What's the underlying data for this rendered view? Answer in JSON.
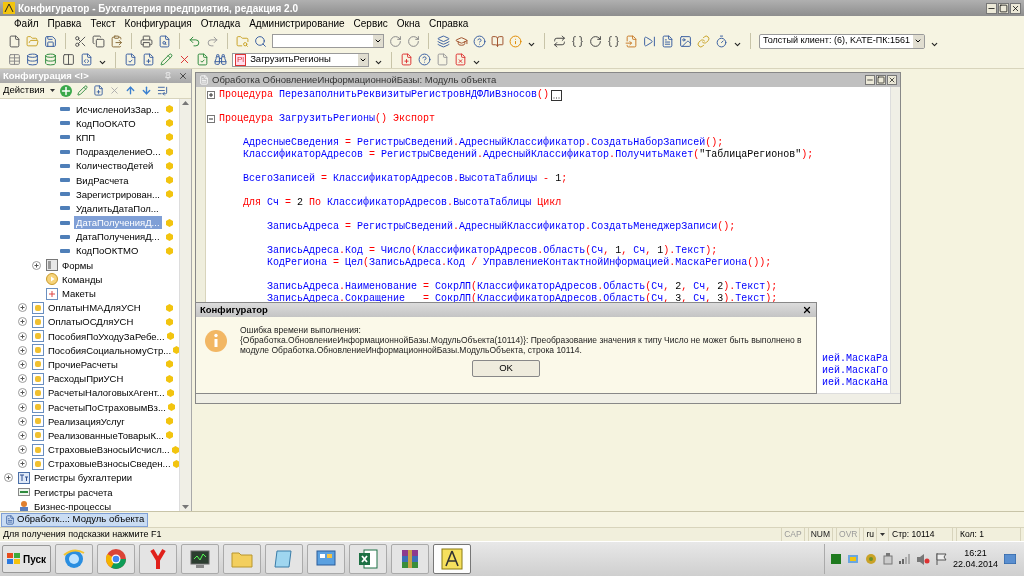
{
  "window": {
    "title": "Конфигуратор - Бухгалтерия предприятия, редакция 2.0"
  },
  "menu": [
    "Файл",
    "Правка",
    "Текст",
    "Конфигурация",
    "Отладка",
    "Администрирование",
    "Сервис",
    "Окна",
    "Справка"
  ],
  "client_combo": "Толстый клиент: (6), KATE-ПК:1561",
  "procedure_combo": {
    "badge": "Pl",
    "value": "ЗагрузитьРегионы"
  },
  "config_panel": {
    "title": "Конфигурация <!>",
    "actions": "Действия",
    "tree": [
      {
        "children": [
          {
            "children": [
              {
                "children": [
                  {
                    "label": "ИсчисленоИзЗар...",
                    "kind": "attribute",
                    "supported": true,
                    "selected": false
                  },
                  {
                    "label": "КодПоОКАТО",
                    "kind": "attribute",
                    "supported": true,
                    "selected": false
                  },
                  {
                    "label": "КПП",
                    "kind": "attribute",
                    "supported": true,
                    "selected": false
                  },
                  {
                    "label": "ПодразделениеО...",
                    "kind": "attribute",
                    "supported": true,
                    "selected": false
                  },
                  {
                    "label": "КоличествоДетей",
                    "kind": "attribute",
                    "supported": true,
                    "selected": false
                  },
                  {
                    "label": "ВидРасчета",
                    "kind": "attribute",
                    "supported": true,
                    "selected": false
                  },
                  {
                    "label": "Зарегистрирован...",
                    "kind": "attribute",
                    "supported": true,
                    "selected": false
                  },
                  {
                    "label": "УдалитьДатаПол...",
                    "kind": "attribute",
                    "supported": false,
                    "selected": false
                  },
                  {
                    "label": "ДатаПолученияД...",
                    "kind": "attribute",
                    "supported": true,
                    "selected": true
                  },
                  {
                    "label": "ДатаПолученияД...",
                    "kind": "attribute",
                    "supported": true,
                    "selected": false
                  },
                  {
                    "label": "КодПоОКТМО",
                    "kind": "attribute",
                    "supported": true,
                    "selected": false
                  }
                ]
              },
              {
                "label": "Формы",
                "kind": "forms",
                "expanded": false,
                "supported": false,
                "selected": false
              },
              {
                "label": "Команды",
                "kind": "commands",
                "supported": false,
                "selected": false
              },
              {
                "label": "Макеты",
                "kind": "templates",
                "supported": false,
                "selected": false
              }
            ]
          },
          {
            "label": "ОплатыНМАДляУСН",
            "kind": "document",
            "expanded": false,
            "supported": true,
            "selected": false
          },
          {
            "label": "ОплатыОСДляУСН",
            "kind": "document",
            "expanded": false,
            "supported": true,
            "selected": false
          },
          {
            "label": "ПособияПоУходуЗаРебе...",
            "kind": "document",
            "expanded": false,
            "supported": true,
            "selected": false
          },
          {
            "label": "ПособияСоциальномуСтр...",
            "kind": "document",
            "expanded": false,
            "supported": true,
            "selected": false
          },
          {
            "label": "ПрочиеРасчеты",
            "kind": "document",
            "expanded": false,
            "supported": true,
            "selected": false
          },
          {
            "label": "РасходыПриУСН",
            "kind": "document",
            "expanded": false,
            "supported": true,
            "selected": false
          },
          {
            "label": "РасчетыНалоговыхАгент...",
            "kind": "document",
            "expanded": false,
            "supported": true,
            "selected": false
          },
          {
            "label": "РасчетыПоСтраховымВз...",
            "kind": "document",
            "expanded": false,
            "supported": true,
            "selected": false
          },
          {
            "label": "РеализацияУслуг",
            "kind": "document",
            "expanded": false,
            "supported": true,
            "selected": false
          },
          {
            "label": "РеализованныеТоварыК...",
            "kind": "document",
            "expanded": false,
            "supported": true,
            "selected": false
          },
          {
            "label": "СтраховыеВзносыИсчисл...",
            "kind": "document",
            "expanded": false,
            "supported": true,
            "selected": false
          },
          {
            "label": "СтраховыеВзносыСведен...",
            "kind": "document",
            "expanded": false,
            "supported": true,
            "selected": false
          }
        ]
      },
      {
        "label": "Регистры бухгалтерии",
        "kind": "acc-register",
        "expanded": false,
        "supported": false,
        "selected": false
      },
      {
        "label": "Регистры расчета",
        "kind": "calc-register",
        "supported": false,
        "selected": false
      },
      {
        "label": "Бизнес-процессы",
        "kind": "business-process",
        "supported": false,
        "selected": false
      }
    ]
  },
  "editor": {
    "title": "Обработка ОбновлениеИнформационнойБазы: Модуль объекта",
    "lines": [
      {
        "kind": "code",
        "collapsed": true,
        "tokens": [
          {
            "kind": "kw",
            "text": "Процедура "
          },
          {
            "kind": "id",
            "text": "ПерезаполнитьРеквизитыРегистровНДФЛиВзносов"
          },
          {
            "kind": "op",
            "text": "()"
          }
        ]
      },
      {
        "kind": "blank"
      },
      {
        "kind": "code",
        "collapsed": false,
        "tokens": [
          {
            "kind": "kw",
            "text": "Процедура "
          },
          {
            "kind": "id",
            "text": "ЗагрузитьРегионы"
          },
          {
            "kind": "op",
            "text": "() "
          },
          {
            "kind": "kw",
            "text": "Экспорт"
          }
        ]
      },
      {
        "kind": "blank"
      },
      {
        "kind": "code",
        "tokens": [
          {
            "kind": "id",
            "text": "    АдресныеСведения "
          },
          {
            "kind": "op",
            "text": "= "
          },
          {
            "kind": "id",
            "text": "РегистрыСведений"
          },
          {
            "kind": "op",
            "text": "."
          },
          {
            "kind": "id",
            "text": "АдресныйКлассификатор"
          },
          {
            "kind": "op",
            "text": "."
          },
          {
            "kind": "id",
            "text": "СоздатьНаборЗаписей"
          },
          {
            "kind": "op",
            "text": "();"
          }
        ]
      },
      {
        "kind": "code",
        "tokens": [
          {
            "kind": "id",
            "text": "    КлассификаторАдресов "
          },
          {
            "kind": "op",
            "text": "= "
          },
          {
            "kind": "id",
            "text": "РегистрыСведений"
          },
          {
            "kind": "op",
            "text": "."
          },
          {
            "kind": "id",
            "text": "АдресныйКлассификатор"
          },
          {
            "kind": "op",
            "text": "."
          },
          {
            "kind": "id",
            "text": "ПолучитьМакет"
          },
          {
            "kind": "op",
            "text": "("
          },
          {
            "kind": "str",
            "text": "\"ТаблицаРегионов\""
          },
          {
            "kind": "op",
            "text": ");"
          }
        ]
      },
      {
        "kind": "blank"
      },
      {
        "kind": "code",
        "tokens": [
          {
            "kind": "id",
            "text": "    ВсегоЗаписей "
          },
          {
            "kind": "op",
            "text": "= "
          },
          {
            "kind": "id",
            "text": "КлассификаторАдресов"
          },
          {
            "kind": "op",
            "text": "."
          },
          {
            "kind": "id",
            "text": "ВысотаТаблицы "
          },
          {
            "kind": "op",
            "text": "- "
          },
          {
            "kind": "num",
            "text": "1"
          },
          {
            "kind": "op",
            "text": ";"
          }
        ]
      },
      {
        "kind": "blank"
      },
      {
        "kind": "code",
        "tokens": [
          {
            "kind": "kw",
            "text": "    Для "
          },
          {
            "kind": "id",
            "text": "Сч "
          },
          {
            "kind": "op",
            "text": "= "
          },
          {
            "kind": "num",
            "text": "2 "
          },
          {
            "kind": "kw",
            "text": "По "
          },
          {
            "kind": "id",
            "text": "КлассификаторАдресов"
          },
          {
            "kind": "op",
            "text": "."
          },
          {
            "kind": "id",
            "text": "ВысотаТаблицы "
          },
          {
            "kind": "kw",
            "text": "Цикл"
          }
        ]
      },
      {
        "kind": "blank"
      },
      {
        "kind": "code",
        "tokens": [
          {
            "kind": "id",
            "text": "        ЗаписьАдреса "
          },
          {
            "kind": "op",
            "text": "= "
          },
          {
            "kind": "id",
            "text": "РегистрыСведений"
          },
          {
            "kind": "op",
            "text": "."
          },
          {
            "kind": "id",
            "text": "АдресныйКлассификатор"
          },
          {
            "kind": "op",
            "text": "."
          },
          {
            "kind": "id",
            "text": "СоздатьМенеджерЗаписи"
          },
          {
            "kind": "op",
            "text": "();"
          }
        ]
      },
      {
        "kind": "blank"
      },
      {
        "kind": "code",
        "tokens": [
          {
            "kind": "id",
            "text": "        ЗаписьАдреса"
          },
          {
            "kind": "op",
            "text": "."
          },
          {
            "kind": "id",
            "text": "Код "
          },
          {
            "kind": "op",
            "text": "= "
          },
          {
            "kind": "id",
            "text": "Число"
          },
          {
            "kind": "op",
            "text": "("
          },
          {
            "kind": "id",
            "text": "КлассификаторАдресов"
          },
          {
            "kind": "op",
            "text": "."
          },
          {
            "kind": "id",
            "text": "Область"
          },
          {
            "kind": "op",
            "text": "("
          },
          {
            "kind": "id",
            "text": "Сч"
          },
          {
            "kind": "op",
            "text": ", "
          },
          {
            "kind": "num",
            "text": "1"
          },
          {
            "kind": "op",
            "text": ", "
          },
          {
            "kind": "id",
            "text": "Сч"
          },
          {
            "kind": "op",
            "text": ", "
          },
          {
            "kind": "num",
            "text": "1"
          },
          {
            "kind": "op",
            "text": ")."
          },
          {
            "kind": "id",
            "text": "Текст"
          },
          {
            "kind": "op",
            "text": ");"
          }
        ]
      },
      {
        "kind": "code",
        "tokens": [
          {
            "kind": "id",
            "text": "        КодРегиона "
          },
          {
            "kind": "op",
            "text": "= "
          },
          {
            "kind": "id",
            "text": "Цел"
          },
          {
            "kind": "op",
            "text": "("
          },
          {
            "kind": "id",
            "text": "ЗаписьАдреса"
          },
          {
            "kind": "op",
            "text": "."
          },
          {
            "kind": "id",
            "text": "Код "
          },
          {
            "kind": "op",
            "text": "/ "
          },
          {
            "kind": "id",
            "text": "УправлениеКонтактнойИнформацией"
          },
          {
            "kind": "op",
            "text": "."
          },
          {
            "kind": "id",
            "text": "МаскаРегиона"
          },
          {
            "kind": "op",
            "text": "());"
          }
        ]
      },
      {
        "kind": "blank"
      },
      {
        "kind": "code",
        "tokens": [
          {
            "kind": "id",
            "text": "        ЗаписьАдреса"
          },
          {
            "kind": "op",
            "text": "."
          },
          {
            "kind": "id",
            "text": "Наименование "
          },
          {
            "kind": "op",
            "text": "= "
          },
          {
            "kind": "id",
            "text": "СокрЛП"
          },
          {
            "kind": "op",
            "text": "("
          },
          {
            "kind": "id",
            "text": "КлассификаторАдресов"
          },
          {
            "kind": "op",
            "text": "."
          },
          {
            "kind": "id",
            "text": "Область"
          },
          {
            "kind": "op",
            "text": "("
          },
          {
            "kind": "id",
            "text": "Сч"
          },
          {
            "kind": "op",
            "text": ", "
          },
          {
            "kind": "num",
            "text": "2"
          },
          {
            "kind": "op",
            "text": ", "
          },
          {
            "kind": "id",
            "text": "Сч"
          },
          {
            "kind": "op",
            "text": ", "
          },
          {
            "kind": "num",
            "text": "2"
          },
          {
            "kind": "op",
            "text": ")."
          },
          {
            "kind": "id",
            "text": "Текст"
          },
          {
            "kind": "op",
            "text": ");"
          }
        ]
      },
      {
        "kind": "code",
        "tokens": [
          {
            "kind": "id",
            "text": "        ЗаписьАдреса"
          },
          {
            "kind": "op",
            "text": "."
          },
          {
            "kind": "id",
            "text": "Сокращение   "
          },
          {
            "kind": "op",
            "text": "= "
          },
          {
            "kind": "id",
            "text": "СокрЛП"
          },
          {
            "kind": "op",
            "text": "("
          },
          {
            "kind": "id",
            "text": "КлассификаторАдресов"
          },
          {
            "kind": "op",
            "text": "."
          },
          {
            "kind": "id",
            "text": "Область"
          },
          {
            "kind": "op",
            "text": "("
          },
          {
            "kind": "id",
            "text": "Сч"
          },
          {
            "kind": "op",
            "text": ", "
          },
          {
            "kind": "num",
            "text": "3"
          },
          {
            "kind": "op",
            "text": ", "
          },
          {
            "kind": "id",
            "text": "Сч"
          },
          {
            "kind": "op",
            "text": ", "
          },
          {
            "kind": "num",
            "text": "3"
          },
          {
            "kind": "op",
            "text": ")."
          },
          {
            "kind": "id",
            "text": "Текст"
          },
          {
            "kind": "op",
            "text": ");"
          }
        ]
      }
    ],
    "tail_lines": [
      "ией.МаскаРа",
      "ией.МаскаГо",
      "ией.МаскаНа"
    ]
  },
  "dialog": {
    "title": "Конфигуратор",
    "heading": "Ошибка времени выполнения:",
    "message": "{Обработка.ОбновлениеИнформационнойБазы.МодульОбъекта(10114)}: Преобразование значения к типу Число не может быть выполнено в модуле Обработка.ОбновлениеИнформационнойБазы.МодульОбъекта, строка 10114.",
    "button": "OK"
  },
  "window_tabs": [
    {
      "label": "Обработк...: Модуль объекта",
      "selected": true
    }
  ],
  "status_bar": {
    "hint": "Для получения подсказки нажмите F1",
    "indicators": [
      {
        "label": "CAP",
        "on": false
      },
      {
        "label": "NUM",
        "on": true
      },
      {
        "label": "OVR",
        "on": false
      }
    ],
    "language": "ru",
    "line": "Стр: 10114",
    "column": "Кол: 1"
  },
  "taskbar": {
    "start": "Пуск",
    "apps": [
      {
        "selected": false
      },
      {
        "selected": false
      },
      {
        "selected": false
      },
      {
        "selected": false
      },
      {
        "selected": false
      },
      {
        "selected": false
      },
      {
        "selected": false
      },
      {
        "selected": false
      },
      {
        "selected": false
      },
      {
        "selected": true
      }
    ],
    "time": "16:21",
    "date": "22.04.2014"
  }
}
